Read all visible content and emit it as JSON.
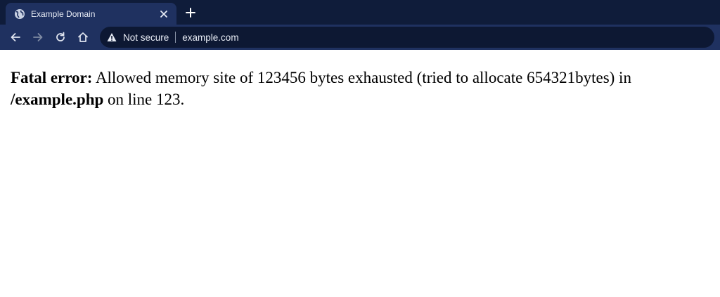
{
  "browser": {
    "tab": {
      "title": "Example Domain"
    },
    "omnibox": {
      "security_label": "Not secure",
      "url": "example.com"
    }
  },
  "page": {
    "error_label": "Fatal error:",
    "error_message": " Allowed memory site of 123456 bytes exhausted (tried to allocate 654321bytes) in ",
    "file_path": "/example.php",
    "line_text": " on line 123."
  },
  "colors": {
    "tabstrip_bg": "#0f1c3a",
    "toolbar_bg": "#1f3160",
    "omnibox_bg": "#0d1833",
    "text_light": "#e8ecf5"
  },
  "icons": {
    "tab_favicon": "globe-icon",
    "tab_close": "close-icon",
    "new_tab": "plus-icon",
    "back": "arrow-left-icon",
    "forward": "arrow-right-icon",
    "reload": "reload-icon",
    "home": "home-icon",
    "security": "warning-triangle-icon"
  }
}
